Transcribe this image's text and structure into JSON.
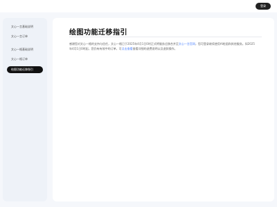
{
  "topbar": {
    "login_label": "登录"
  },
  "sidebar": {
    "items": [
      {
        "label": "文心一言基础说明"
      },
      {
        "label": "文心一言订单"
      },
      {
        "label": "文心一格基础说明"
      },
      {
        "label": "文心一格订单"
      },
      {
        "label": "绘图功能迁移指引",
        "active": true
      }
    ]
  },
  "main": {
    "title": "绘图功能迁移指引",
    "paragraph": {
      "p1": "感谢您对文心一格的支持与信任，文心一格已于2025年4月1日0时正式将服务迁移合并至",
      "link1": "文心一言官网",
      "p2": "，您可登录继续使用AI绘画和其他服务。如2025年4月1日0时起，您仍有有效中的订单，可",
      "link2": "点击查看",
      "p3": "查看详细的退费说明以及退款操作。"
    }
  }
}
